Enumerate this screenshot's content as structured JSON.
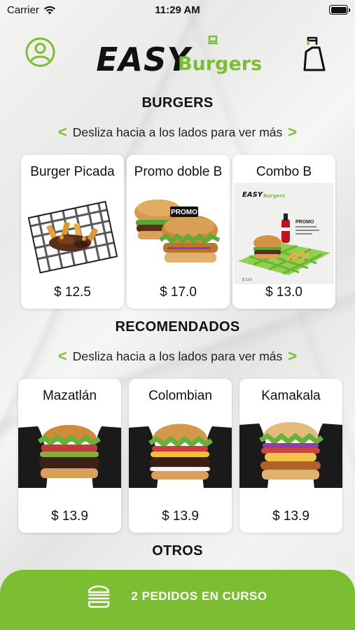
{
  "status_bar": {
    "carrier": "Carrier",
    "time": "11:29 AM"
  },
  "header": {
    "logo_main": "EASY",
    "logo_sub": "Burgers"
  },
  "sections": {
    "burgers": {
      "title": "BURGERS",
      "hint": "Desliza hacia a los lados para ver más",
      "items": [
        {
          "name": "Burger Picada",
          "price": "$ 12.5"
        },
        {
          "name": "Promo doble B",
          "price": "$ 17.0",
          "badge": "PROMO"
        },
        {
          "name": "Combo B",
          "price": "$ 13.0",
          "flyer_brand": "EASY",
          "flyer_sub": "Burgers",
          "flyer_tag": "PROMO"
        }
      ]
    },
    "recomendados": {
      "title": "RECOMENDADOS",
      "hint": "Desliza hacia a los lados para ver más",
      "items": [
        {
          "name": "Mazatlán",
          "price": "$ 13.9"
        },
        {
          "name": "Colombian",
          "price": "$ 13.9"
        },
        {
          "name": "Kamakala",
          "price": "$ 13.9"
        }
      ]
    },
    "otros": {
      "title": "OTROS"
    }
  },
  "footer": {
    "orders_label": "2 PEDIDOS EN CURSO"
  },
  "colors": {
    "accent": "#7cbe32",
    "text": "#111111",
    "card": "#ffffff"
  },
  "icons": {
    "profile": "user-circle-icon",
    "cart": "shopping-bag-icon",
    "hint_left": "chevron-left-icon",
    "hint_right": "chevron-right-icon",
    "footer": "burger-icon"
  }
}
